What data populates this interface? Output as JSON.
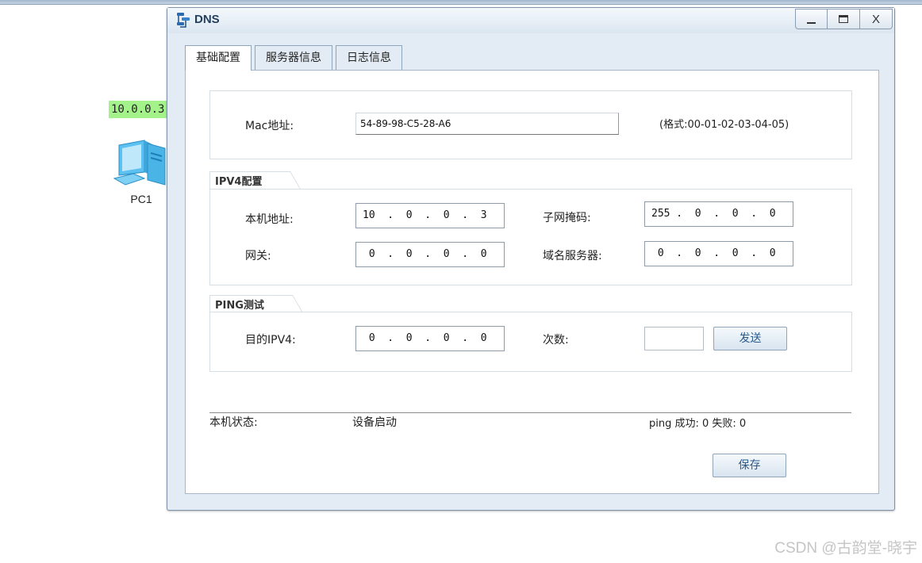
{
  "canvas": {
    "ip_label": "10.0.0.3",
    "pc_label": "PC1"
  },
  "window": {
    "title": "DNS",
    "title_icon": "dns-server-icon",
    "minimize_icon": "minimize-icon",
    "maximize_icon": "maximize-icon",
    "close_label": "X"
  },
  "tabs": [
    {
      "label": "基础配置",
      "active": true
    },
    {
      "label": "服务器信息",
      "active": false
    },
    {
      "label": "日志信息",
      "active": false
    }
  ],
  "mac": {
    "label": "Mac地址:",
    "value": "54-89-98-C5-28-A6",
    "hint": "(格式:00-01-02-03-04-05)"
  },
  "ipv4": {
    "section_title": "IPV4配置",
    "local_ip_label": "本机地址:",
    "local_ip": "10  .  0  .  0  .  3",
    "subnet_label": "子网掩码:",
    "subnet": "255 .  0  .  0  .  0",
    "gateway_label": "网关:",
    "gateway": " 0  .  0  .  0  .  0",
    "dns_label": "域名服务器:",
    "dns": " 0  .  0  .  0  .  0"
  },
  "ping": {
    "section_title": "PING测试",
    "target_label": "目的IPV4:",
    "target": " 0  .  0  .  0  .  0",
    "count_label": "次数:",
    "count": "",
    "send_label": "发送"
  },
  "status": {
    "label": "本机状态:",
    "value": "设备启动",
    "ping_result": "ping 成功: 0 失败: 0"
  },
  "save_label": "保存",
  "watermark": "CSDN @古韵堂-晓宇",
  "colors": {
    "ip_tag_bg": "#a4f28a",
    "window_bg": "#e3ecf5",
    "button_text": "#2a5a8a"
  }
}
